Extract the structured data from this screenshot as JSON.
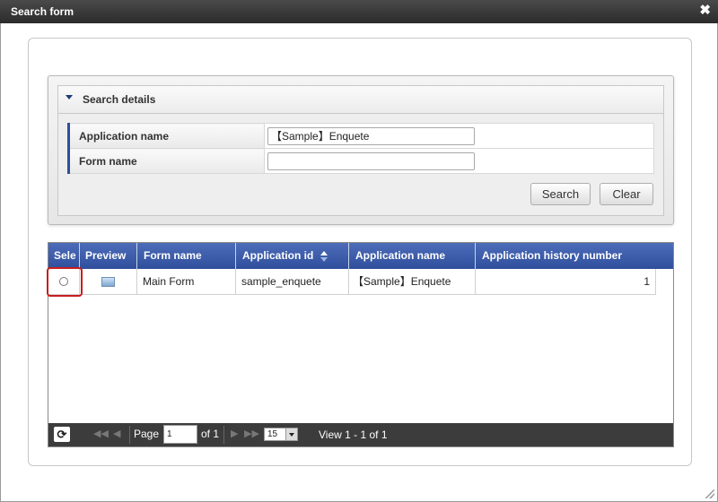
{
  "window": {
    "title": "Search form",
    "close_glyph": "✖"
  },
  "search": {
    "header_label": "Search details",
    "fields": [
      {
        "label": "Application name",
        "value": "【Sample】Enquete",
        "placeholder": ""
      },
      {
        "label": "Form name",
        "value": "",
        "placeholder": ""
      }
    ],
    "search_button": "Search",
    "clear_button": "Clear"
  },
  "grid": {
    "columns": [
      "Sele",
      "Preview",
      "Form name",
      "Application id",
      "Application name",
      "Application history number"
    ],
    "sorted_column": "Application id",
    "rows": [
      {
        "selected": false,
        "preview_icon": "image-preview-icon",
        "form_name": "Main Form",
        "application_id": "sample_enquete",
        "application_name": "【Sample】Enquete",
        "application_history_number": "1"
      }
    ],
    "highlight_color": "#c81e1e",
    "header_color": "#3a5aa8"
  },
  "pager": {
    "page_label": "Page",
    "page_value": "1",
    "of_label": "of 1",
    "rows_per_page": "15",
    "view_text": "View 1 - 1 of 1"
  }
}
